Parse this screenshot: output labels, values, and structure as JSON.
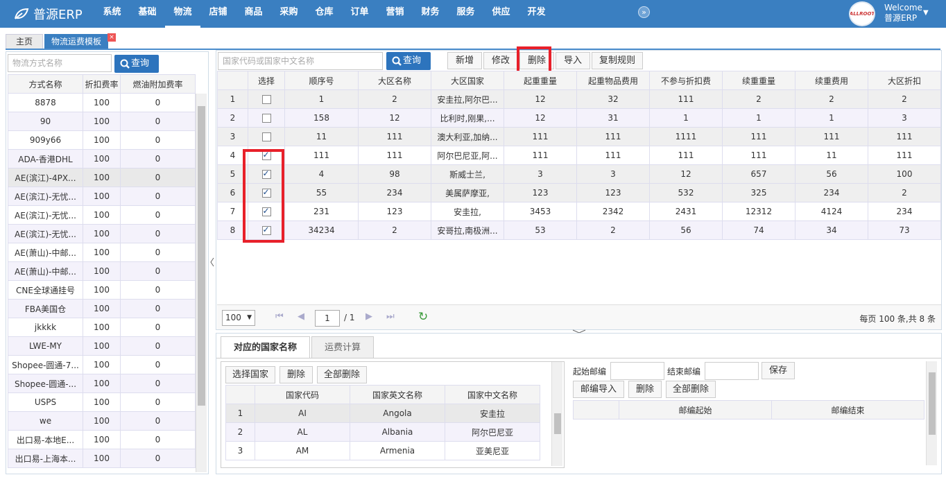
{
  "app": {
    "brand": "普源ERP"
  },
  "nav": [
    "系统",
    "基础",
    "物流",
    "店铺",
    "商品",
    "采购",
    "仓库",
    "订单",
    "营销",
    "财务",
    "服务",
    "供应",
    "开发"
  ],
  "user": {
    "welcome": "Welcome",
    "name": "普源ERP",
    "avatar_text": "ALLROOT"
  },
  "tabs": {
    "home": "主页",
    "current": "物流运费模板"
  },
  "left": {
    "search_placeholder": "物流方式名称",
    "query": "查询",
    "headers": [
      "方式名称",
      "折扣费率",
      "燃油附加费率"
    ],
    "rows": [
      [
        "8878",
        "100",
        "0"
      ],
      [
        "90",
        "100",
        "0"
      ],
      [
        "909y66",
        "100",
        "0"
      ],
      [
        "ADA-香港DHL",
        "100",
        "0"
      ],
      [
        "AE(滨江)-4PX...",
        "100",
        "0"
      ],
      [
        "AE(滨江)-无忧...",
        "100",
        "0"
      ],
      [
        "AE(滨江)-无忧...",
        "100",
        "0"
      ],
      [
        "AE(滨江)-无忧...",
        "100",
        "0"
      ],
      [
        "AE(萧山)-中邮...",
        "100",
        "0"
      ],
      [
        "AE(萧山)-中邮...",
        "100",
        "0"
      ],
      [
        "CNE全球通挂号",
        "100",
        "0"
      ],
      [
        "FBA美国仓",
        "100",
        "0"
      ],
      [
        "jkkkk",
        "100",
        "0"
      ],
      [
        "LWE-MY",
        "100",
        "0"
      ],
      [
        "Shopee-圆通-7...",
        "100",
        "0"
      ],
      [
        "Shopee-圆通-...",
        "100",
        "0"
      ],
      [
        "USPS",
        "100",
        "0"
      ],
      [
        "we",
        "100",
        "0"
      ],
      [
        "出口易-本地E...",
        "100",
        "0"
      ],
      [
        "出口易-上海本...",
        "100",
        "0"
      ]
    ]
  },
  "right": {
    "search_placeholder": "国家代码或国家中文名称",
    "query": "查询",
    "buttons": {
      "add": "新增",
      "edit": "修改",
      "delete": "删除",
      "import": "导入",
      "copy": "复制规则"
    },
    "headers": [
      "选择",
      "顺序号",
      "大区名称",
      "大区国家",
      "起重重量",
      "起重物品费用",
      "不参与折扣费",
      "续重重量",
      "续重费用",
      "大区折扣"
    ],
    "rows": [
      {
        "idx": "1",
        "checked": false,
        "cells": [
          "1",
          "2",
          "安圭拉,阿尔巴...",
          "12",
          "32",
          "111",
          "2",
          "2",
          "2"
        ]
      },
      {
        "idx": "2",
        "checked": false,
        "cells": [
          "158",
          "12",
          "比利时,刚果,...",
          "12",
          "31",
          "1",
          "1",
          "1",
          "3"
        ]
      },
      {
        "idx": "3",
        "checked": false,
        "cells": [
          "11",
          "111",
          "澳大利亚,加纳...",
          "111",
          "111",
          "1111",
          "111",
          "111",
          "111"
        ]
      },
      {
        "idx": "4",
        "checked": true,
        "cells": [
          "111",
          "111",
          "阿尔巴尼亚,阿...",
          "111",
          "111",
          "111",
          "111",
          "11",
          "111"
        ]
      },
      {
        "idx": "5",
        "checked": true,
        "cells": [
          "4",
          "98",
          "斯威士兰,",
          "3",
          "3",
          "12",
          "657",
          "56",
          "100"
        ]
      },
      {
        "idx": "6",
        "checked": true,
        "cells": [
          "55",
          "234",
          "美属萨摩亚,",
          "123",
          "123",
          "532",
          "325",
          "234",
          "2"
        ]
      },
      {
        "idx": "7",
        "checked": true,
        "cells": [
          "231",
          "123",
          "安圭拉,",
          "3453",
          "2342",
          "2431",
          "12312",
          "4124",
          "234"
        ]
      },
      {
        "idx": "8",
        "checked": true,
        "cells": [
          "34234",
          "2",
          "安哥拉,南极洲...",
          "53",
          "2",
          "56",
          "74",
          "34",
          "73"
        ]
      }
    ],
    "pager": {
      "page_size": "100",
      "page": "1",
      "of": "/ 1",
      "summary": "每页 100 条,共 8 条"
    }
  },
  "bottom": {
    "tabs": [
      "对应的国家名称",
      "运费计算"
    ],
    "country_buttons": [
      "选择国家",
      "删除",
      "全部删除"
    ],
    "country_headers": [
      "国家代码",
      "国家英文名称",
      "国家中文名称"
    ],
    "countries": [
      [
        "1",
        "AI",
        "Angola",
        "安圭拉"
      ],
      [
        "2",
        "AL",
        "Albania",
        "阿尔巴尼亚"
      ],
      [
        "3",
        "AM",
        "Armenia",
        "亚美尼亚"
      ]
    ],
    "zip": {
      "start_label": "起始邮编",
      "end_label": "结束邮编",
      "save": "保存",
      "import": "邮编导入",
      "delete": "删除",
      "delete_all": "全部删除",
      "headers": [
        "邮编起始",
        "邮编结束"
      ]
    }
  },
  "colors": {
    "primary": "#3a7fc1",
    "button": "#2d74bd",
    "highlight": "#e8202a"
  }
}
